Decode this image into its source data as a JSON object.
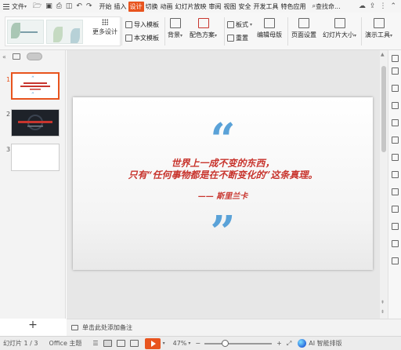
{
  "menubar": {
    "file_label": "文件",
    "quick_icons": [
      "folder-icon",
      "save-icon",
      "print-icon",
      "preview-icon",
      "undo-icon",
      "redo-icon"
    ],
    "tabs": [
      {
        "label": "开始",
        "active": false
      },
      {
        "label": "插入",
        "active": false
      },
      {
        "label": "设计",
        "active": true
      },
      {
        "label": "切换",
        "active": false
      },
      {
        "label": "动画",
        "active": false
      },
      {
        "label": "幻灯片放映",
        "active": false
      },
      {
        "label": "审阅",
        "active": false
      },
      {
        "label": "视图",
        "active": false
      },
      {
        "label": "安全",
        "active": false
      },
      {
        "label": "开发工具",
        "active": false
      },
      {
        "label": "特色应用",
        "active": false
      }
    ],
    "search_label": "查找命...",
    "accent_color": "#e8541e"
  },
  "ribbon": {
    "more_designs": "更多设计",
    "import_template": "导入模板",
    "text_template": "本文模板",
    "background": "背景",
    "color_scheme": "配色方案",
    "layout": "板式",
    "reset": "重置",
    "edit_master": "编辑母版",
    "page_setup": "页面设置",
    "slide_size": "幻灯片大小",
    "present_tools": "演示工具"
  },
  "slide_panel": {
    "slides": [
      {
        "number": "1",
        "current": true,
        "style": "light"
      },
      {
        "number": "2",
        "current": false,
        "style": "dark"
      },
      {
        "number": "3",
        "current": false,
        "style": "blank"
      }
    ],
    "add_label": "+"
  },
  "slide": {
    "open_quote": "“",
    "line1": "世界上一成不变的东西，",
    "line2": "只有“任何事物都是在不断变化的”这条真理。",
    "author": "—— 斯里兰卡",
    "close_quote": "”",
    "quote_color": "#5aa2d8",
    "text_color": "#c8352e"
  },
  "notes": {
    "placeholder": "单击此处添加备注"
  },
  "status": {
    "slide_counter": "幻灯片 1 / 3",
    "theme": "Office 主题",
    "zoom": "47%",
    "zoom_level": 0.3,
    "ai_label": "AI 智能排版"
  }
}
